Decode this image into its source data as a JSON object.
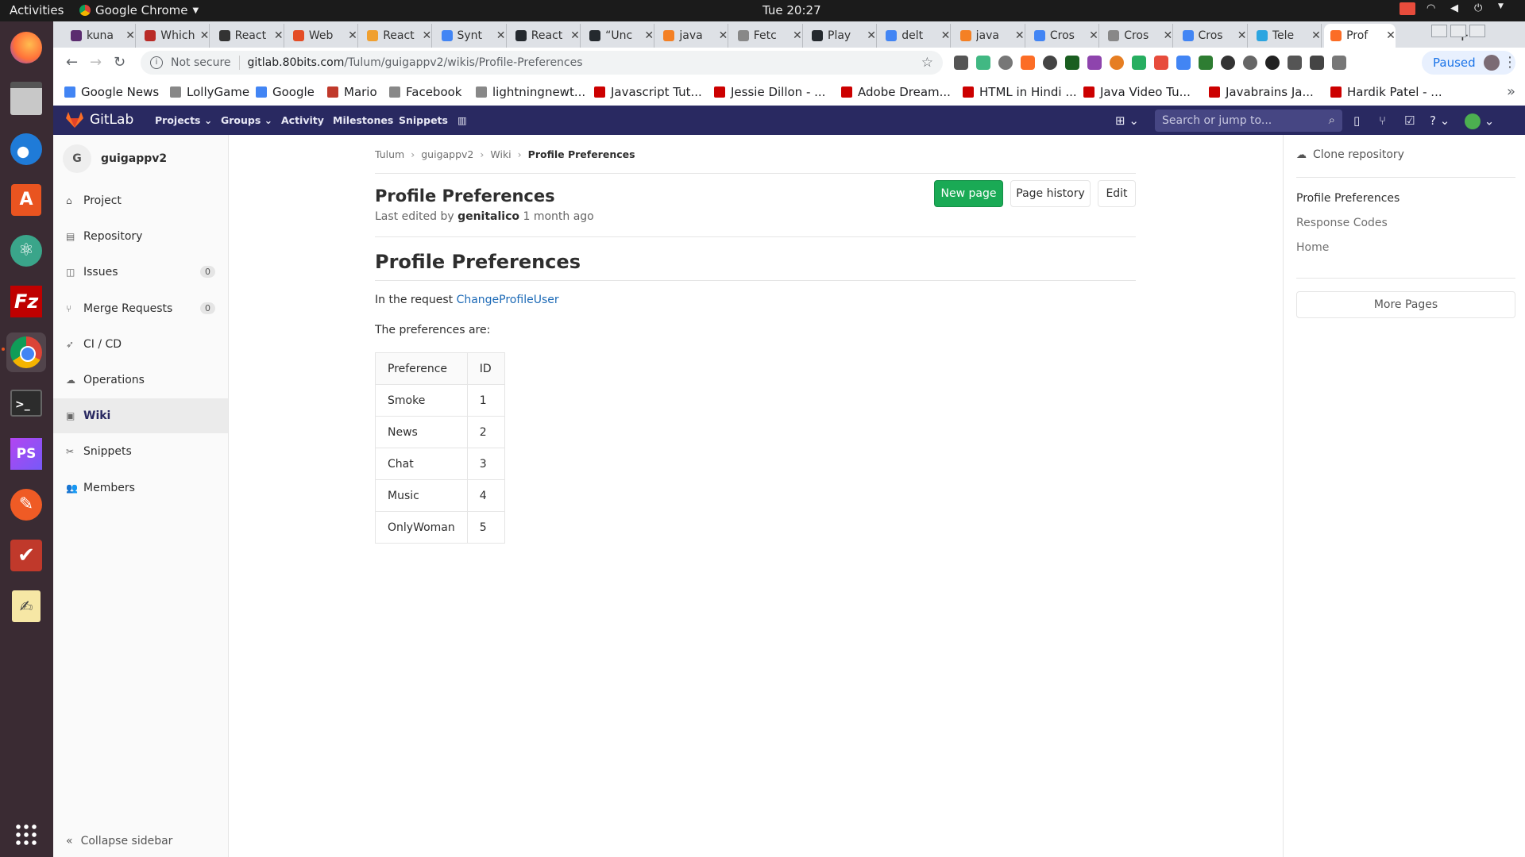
{
  "os": {
    "activities": "Activities",
    "app_name": "Google Chrome",
    "clock": "Tue 20:27"
  },
  "tabs": [
    {
      "title": "kuna",
      "color": "#5b2c6f"
    },
    {
      "title": "Which",
      "color": "#b92b27"
    },
    {
      "title": "React",
      "color": "#333333"
    },
    {
      "title": "Web",
      "color": "#e44d26"
    },
    {
      "title": "React",
      "color": "#f0a030"
    },
    {
      "title": "Synt",
      "color": "#4285f4"
    },
    {
      "title": "React",
      "color": "#24292e"
    },
    {
      "title": "“Unc",
      "color": "#24292e"
    },
    {
      "title": "java",
      "color": "#f48024"
    },
    {
      "title": "Fetc",
      "color": "#888888"
    },
    {
      "title": "Play",
      "color": "#24292e"
    },
    {
      "title": "delt",
      "color": "#4285f4"
    },
    {
      "title": "java",
      "color": "#f48024"
    },
    {
      "title": "Cros",
      "color": "#4285f4"
    },
    {
      "title": "Cros",
      "color": "#888888"
    },
    {
      "title": "Cros",
      "color": "#4285f4"
    },
    {
      "title": "Tele",
      "color": "#2ca5e0"
    },
    {
      "title": "Prof",
      "color": "#fc6d26",
      "active": true
    }
  ],
  "omnibox": {
    "security": "Not secure",
    "host": "gitlab.80bits.com",
    "path": "/Tulum/guigappv2/wikis/Profile-Preferences"
  },
  "profile_status": "Paused",
  "bookmarks": [
    {
      "label": "Google News",
      "icon_color": "#4285f4"
    },
    {
      "label": "LollyGame",
      "icon_color": "#888888"
    },
    {
      "label": "Google",
      "icon_color": "#4285f4"
    },
    {
      "label": "Mario",
      "icon_color": "#c0392b"
    },
    {
      "label": "Facebook",
      "icon_color": "#888888"
    },
    {
      "label": "lightningnewt...",
      "icon_color": "#888888"
    },
    {
      "label": "Javascript Tut...",
      "icon_color": "#cc0000"
    },
    {
      "label": "Jessie Dillon - ...",
      "icon_color": "#cc0000"
    },
    {
      "label": "Adobe Dream...",
      "icon_color": "#cc0000"
    },
    {
      "label": "HTML in Hindi ...",
      "icon_color": "#cc0000"
    },
    {
      "label": "Java Video Tu...",
      "icon_color": "#cc0000"
    },
    {
      "label": "Javabrains Ja...",
      "icon_color": "#cc0000"
    },
    {
      "label": "Hardik Patel - ...",
      "icon_color": "#cc0000"
    }
  ],
  "gitlab": {
    "brand": "GitLab",
    "nav": {
      "projects": "Projects",
      "groups": "Groups",
      "activity": "Activity",
      "milestones": "Milestones",
      "snippets": "Snippets"
    },
    "search_placeholder": "Search or jump to...",
    "brand_color": "#292961",
    "accent_orange": "#fc6d26"
  },
  "sidebar": {
    "project_initial": "G",
    "project_name": "guigappv2",
    "items": [
      {
        "label": "Project",
        "icon": "home-icon"
      },
      {
        "label": "Repository",
        "icon": "book-icon"
      },
      {
        "label": "Issues",
        "icon": "issues-icon",
        "badge": "0"
      },
      {
        "label": "Merge Requests",
        "icon": "merge-icon",
        "badge": "0"
      },
      {
        "label": "CI / CD",
        "icon": "rocket-icon"
      },
      {
        "label": "Operations",
        "icon": "cloud-icon"
      },
      {
        "label": "Wiki",
        "icon": "wiki-icon",
        "active": true
      },
      {
        "label": "Snippets",
        "icon": "scissors-icon"
      },
      {
        "label": "Members",
        "icon": "users-icon"
      }
    ],
    "collapse_label": "Collapse sidebar"
  },
  "breadcrumb": [
    "Tulum",
    "guigappv2",
    "Wiki",
    "Profile Preferences"
  ],
  "page": {
    "title": "Profile Preferences",
    "last_edited_prefix": "Last edited by",
    "last_edited_by": "genitalico",
    "last_edited_when": "1 month ago",
    "buttons": {
      "new_page": "New page",
      "page_history": "Page history",
      "edit": "Edit"
    },
    "content_title": "Profile Preferences",
    "intro_prefix": "In the request",
    "intro_link": "ChangeProfileUser",
    "intro2": "The preferences are:",
    "table": {
      "headers": [
        "Preference",
        "ID"
      ],
      "rows": [
        [
          "Smoke",
          "1"
        ],
        [
          "News",
          "2"
        ],
        [
          "Chat",
          "3"
        ],
        [
          "Music",
          "4"
        ],
        [
          "OnlyWoman",
          "5"
        ]
      ]
    }
  },
  "right_sidebar": {
    "clone_label": "Clone repository",
    "pages": [
      "Profile Preferences",
      "Response Codes",
      "Home"
    ],
    "more_pages": "More Pages"
  },
  "colors": {
    "green_button": "#1aaa55",
    "link_blue": "#1b69b6"
  }
}
